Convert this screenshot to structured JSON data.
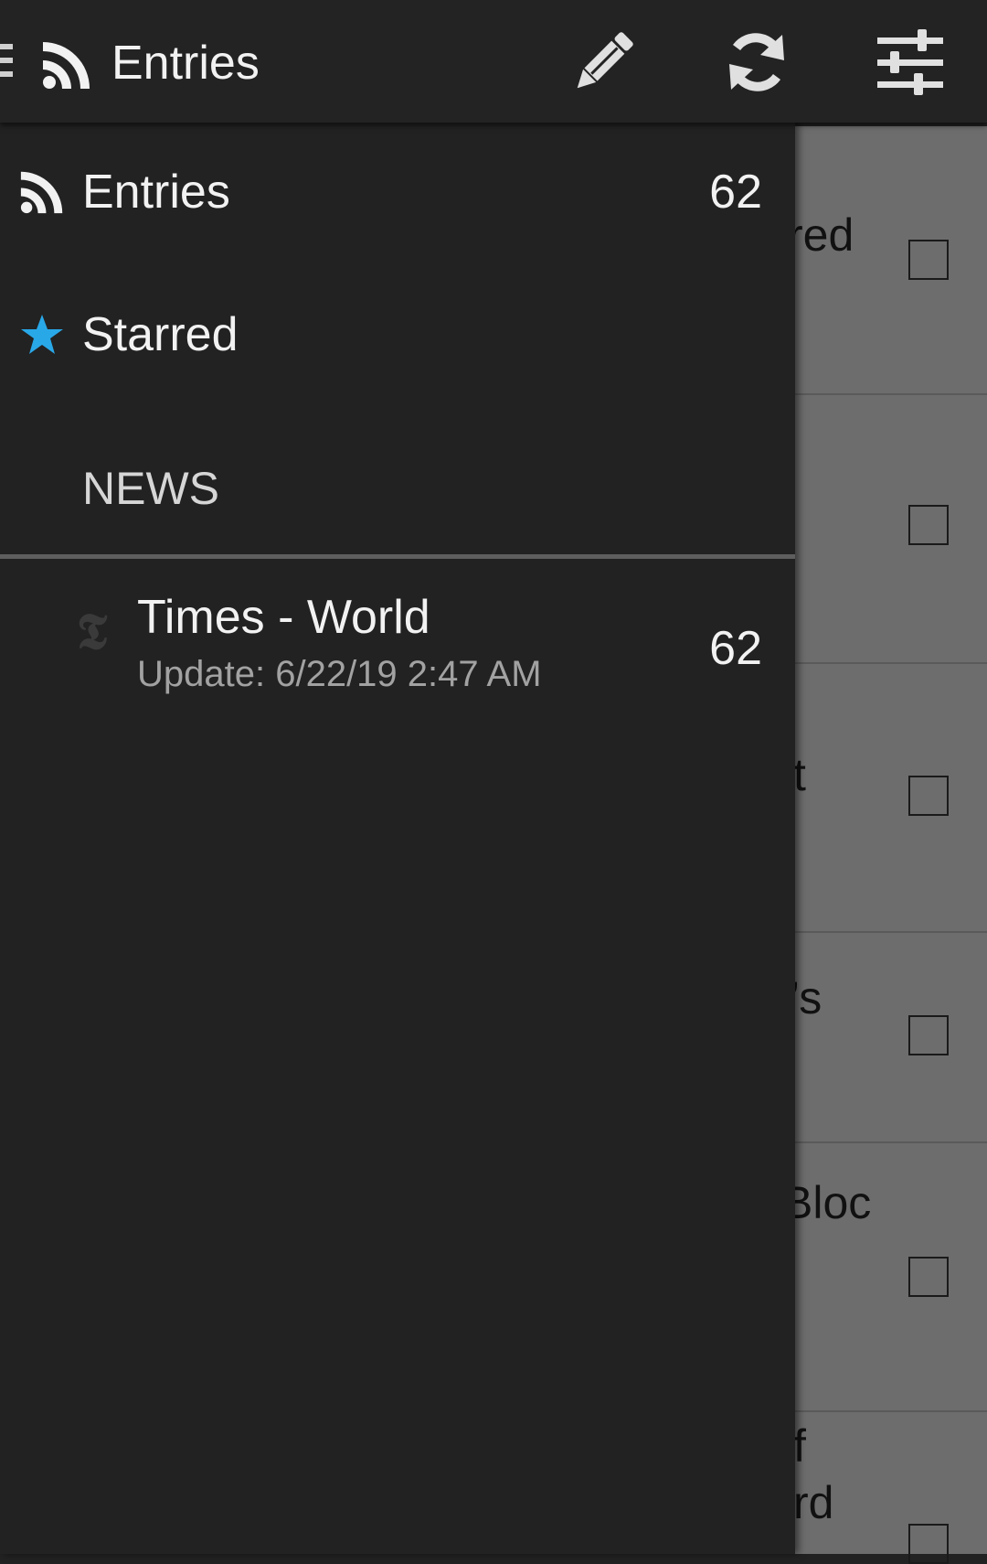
{
  "toolbar": {
    "title": "Entries",
    "icons": [
      "menu-icon",
      "rss-icon",
      "edit-icon",
      "refresh-icon",
      "filter-icon"
    ]
  },
  "drawer": {
    "entries": {
      "label": "Entries",
      "count": "62",
      "icon": "rss-icon"
    },
    "starred": {
      "label": "Starred",
      "icon": "star-icon",
      "icon_color": "#29a8e8"
    },
    "section_header": "NEWS",
    "feed": {
      "title": "Times - World",
      "update": "Update: 6/22/19 2:47 AM",
      "count": "62",
      "logo_glyph": "𝕿"
    }
  },
  "background_list": {
    "items": [
      {
        "text": "red"
      },
      {
        "text": ""
      },
      {
        "text": "t"
      },
      {
        "text": "’s"
      },
      {
        "text": "Bloc"
      },
      {
        "text": "f\nrd"
      }
    ]
  },
  "colors": {
    "toolbar_bg": "#232323",
    "drawer_bg": "#222222",
    "accent_star": "#29a8e8",
    "overlay_list_bg": "#6d6d6d"
  }
}
